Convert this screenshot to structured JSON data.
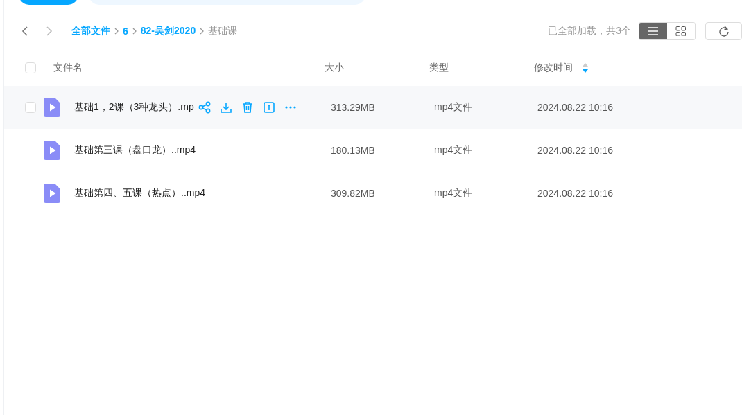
{
  "breadcrumb": {
    "back_disabled": false,
    "forward_disabled": true,
    "items": [
      {
        "label": "全部文件",
        "current": false
      },
      {
        "label": "6",
        "current": false
      },
      {
        "label": "82-吴剑2020",
        "current": false
      },
      {
        "label": "基础课",
        "current": true
      }
    ]
  },
  "load_status": "已全部加载，共3个",
  "view_modes": [
    {
      "kind": "list",
      "selected": true
    },
    {
      "kind": "grid",
      "selected": false
    }
  ],
  "columns": [
    {
      "label": "文件名"
    },
    {
      "label": "大小"
    },
    {
      "label": "类型"
    },
    {
      "label": "修改时间",
      "sorted_descending": true
    }
  ],
  "select_all_checked": false,
  "rows": [
    {
      "name": "基础1，2课（3种龙头）.mp",
      "size": "313.29MB",
      "type": "mp4文件",
      "modified": "2024.08.22 10:16",
      "hovered": true,
      "checked": false
    },
    {
      "name": "基础第三课（盘口龙）..mp4",
      "size": "180.13MB",
      "type": "mp4文件",
      "modified": "2024.08.22 10:16",
      "hovered": false,
      "checked": false
    },
    {
      "name": "基础第四、五课（热点）..mp4",
      "size": "309.82MB",
      "type": "mp4文件",
      "modified": "2024.08.22 10:16",
      "hovered": false,
      "checked": false
    }
  ]
}
